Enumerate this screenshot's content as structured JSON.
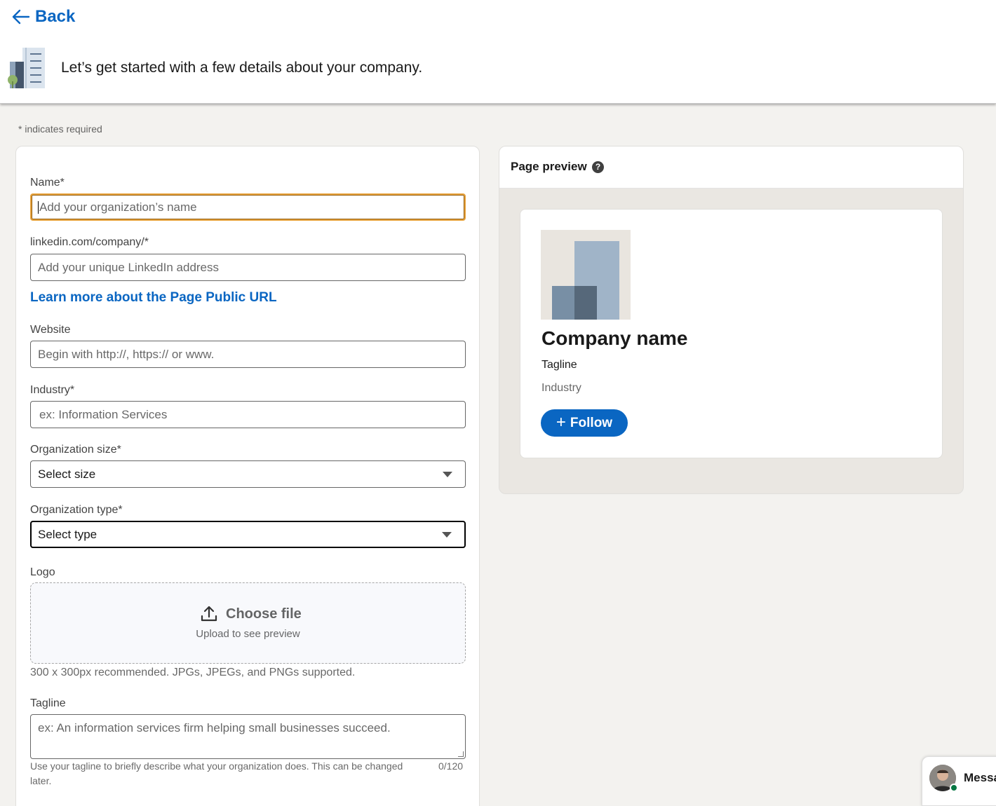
{
  "header": {
    "back_label": "Back",
    "title": "Let’s get started with a few details about your company."
  },
  "form": {
    "required_note": "*  indicates required",
    "name_label": "Name*",
    "name_placeholder": "Add your organization’s name",
    "url_label": "linkedin.com/company/*",
    "url_placeholder": "Add your unique LinkedIn address",
    "learn_more_link": "Learn more about the Page Public URL",
    "website_label": "Website",
    "website_placeholder": "Begin with http://, https:// or www.",
    "industry_label": "Industry*",
    "industry_placeholder": "ex: Information Services",
    "size_label": "Organization size*",
    "size_value": "Select size",
    "type_label": "Organization type*",
    "type_value": "Select type",
    "logo_label": "Logo",
    "logo_choose": "Choose file",
    "logo_sub": "Upload to see preview",
    "logo_helper": "300 x 300px recommended. JPGs, JPEGs, and PNGs supported.",
    "tagline_label": "Tagline",
    "tagline_placeholder": "ex: An information services firm helping small businesses succeed.",
    "tagline_helper": "Use your tagline to briefly describe what your organization does. This can be changed later.",
    "tagline_counter": "0/120"
  },
  "preview": {
    "title": "Page preview",
    "help_icon": "question-circle-icon",
    "company_name": "Company name",
    "tagline": "Tagline",
    "industry": "Industry",
    "follow_label": "Follow"
  },
  "messaging": {
    "label": "Messa"
  },
  "colors": {
    "accent": "#0a66c2",
    "focus": "#e7a33e",
    "background": "#f3f2ef"
  }
}
